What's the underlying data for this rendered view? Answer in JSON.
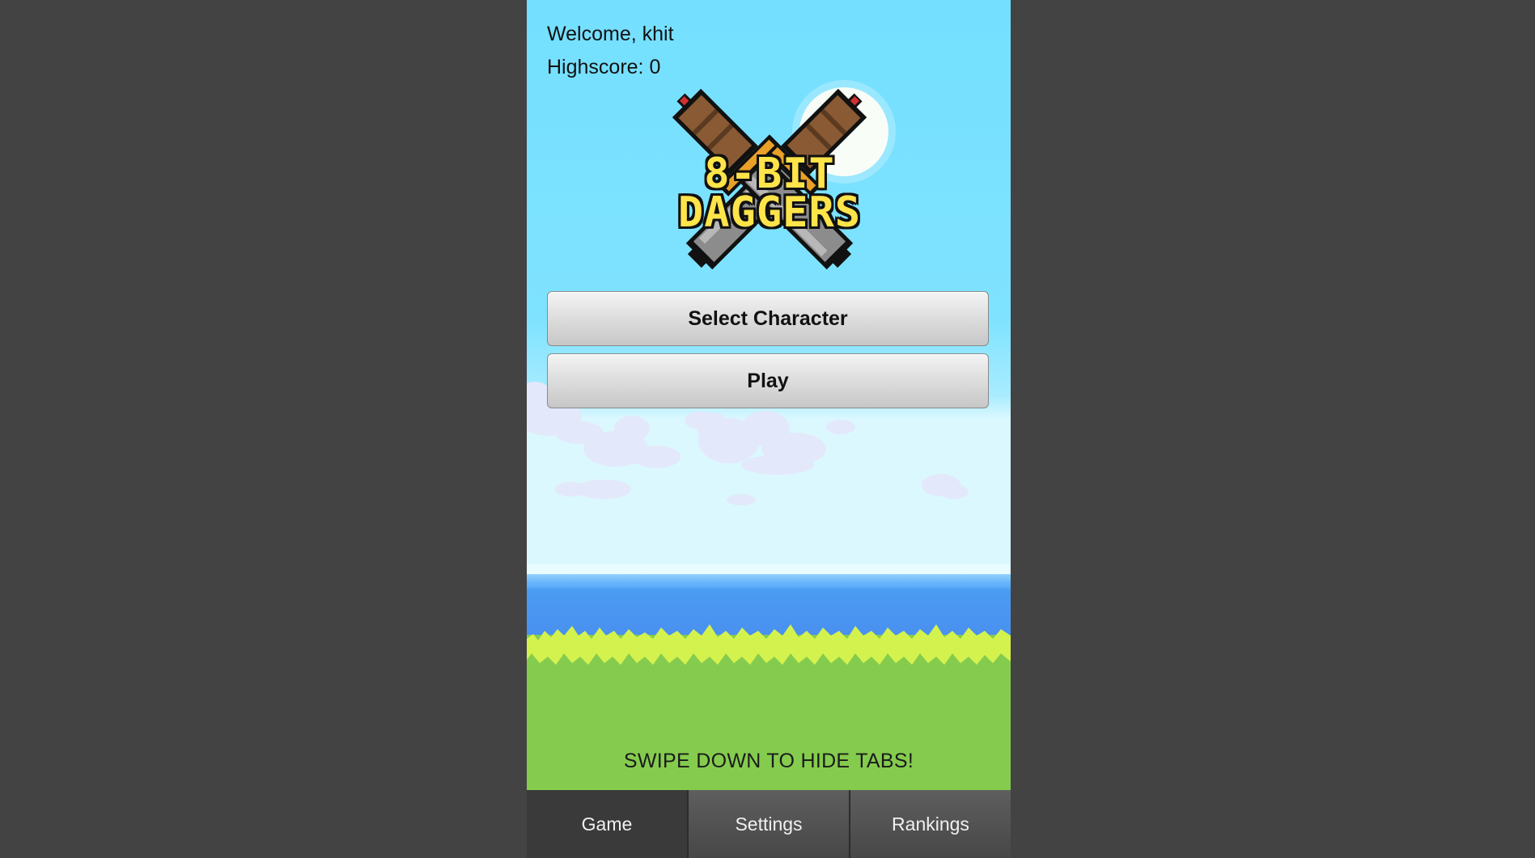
{
  "header": {
    "welcome": "Welcome, khit",
    "highscore": "Highscore: 0"
  },
  "logo": {
    "line1": "8-BIT",
    "line2": "DAGGERS"
  },
  "menu": {
    "select_character": "Select Character",
    "play": "Play"
  },
  "hint": "SWIPE DOWN TO HIDE TABS!",
  "tabs": [
    {
      "label": "Game",
      "active": true
    },
    {
      "label": "Settings",
      "active": false
    },
    {
      "label": "Rankings",
      "active": false
    }
  ],
  "colors": {
    "sky": "#76e0ff",
    "sea": "#4e9df0",
    "grass": "#85cc4e",
    "grass_tips": "#d4f24e",
    "logo_text": "#ffe44a",
    "tab_bar": "#3c3c3c",
    "page_background": "#434343"
  }
}
